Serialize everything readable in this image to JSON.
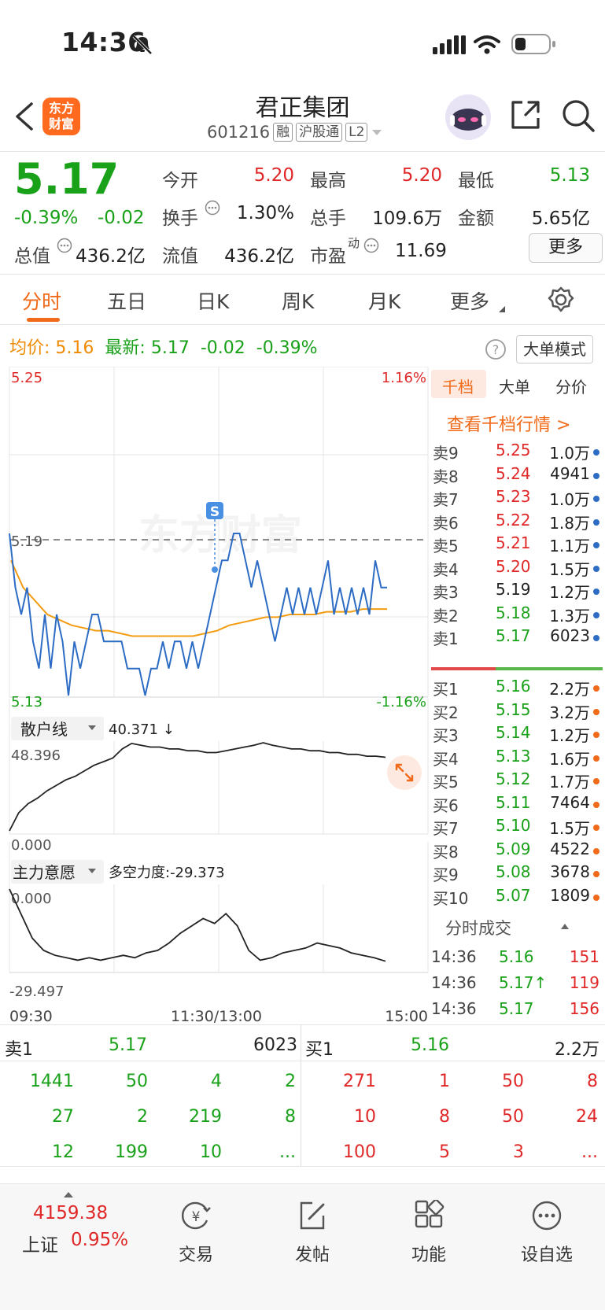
{
  "status": {
    "time": "14:36"
  },
  "header": {
    "logo_text": "东方\n财富",
    "title": "君正集团",
    "code": "601216",
    "tags": [
      "融",
      "沪股通",
      "L2"
    ]
  },
  "quote": {
    "price": "5.17",
    "change_pct": "-0.39%",
    "change": "-0.02",
    "open_label": "今开",
    "open": "5.20",
    "high_label": "最高",
    "high": "5.20",
    "low_label": "最低",
    "low": "5.13",
    "turnover_label": "换手",
    "turnover": "1.30%",
    "volume_label": "总手",
    "volume": "109.6万",
    "amount_label": "金额",
    "amount": "5.65亿",
    "mktcap_label": "总值",
    "mktcap": "436.2亿",
    "float_label": "流值",
    "float": "436.2亿",
    "pe_label": "市盈",
    "pe_sup": "动",
    "pe": "11.69",
    "more": "更多"
  },
  "tabs": [
    "分时",
    "五日",
    "日K",
    "周K",
    "月K",
    "更多"
  ],
  "legend": {
    "avg_label": "均价:",
    "avg": "5.16",
    "latest_label": "最新:",
    "latest": "5.17",
    "chg": "-0.02",
    "pct": "-0.39%",
    "big_order_mode": "大单模式"
  },
  "chart_axes": {
    "price_top": "5.25",
    "price_mid": "5.19",
    "price_bot": "5.13",
    "pct_top": "1.16%",
    "pct_bot": "-1.16%",
    "times": [
      "09:30",
      "11:30/13:00",
      "15:00"
    ],
    "watermark": "东方财富",
    "marker": "S"
  },
  "indicator1": {
    "name": "散户线",
    "value": "40.371 ↓",
    "max": "48.396",
    "min": "0.000"
  },
  "indicator2": {
    "name": "主力意愿",
    "value": "多空力度:-29.373",
    "max": "0.000",
    "min": "-29.497"
  },
  "chart_data": [
    {
      "type": "line",
      "title": "",
      "series": [
        {
          "name": "",
          "values": [
            5.19,
            5.17,
            5.16,
            5.17,
            5.15,
            5.14,
            5.16,
            5.14,
            5.16,
            5.15,
            5.13,
            5.15,
            5.14,
            5.15,
            5.16,
            5.16,
            5.15,
            5.15,
            5.15,
            5.15,
            5.14,
            5.14,
            5.14,
            5.13,
            5.14,
            5.14,
            5.15,
            5.14,
            5.15,
            5.15,
            5.14,
            5.15,
            5.14,
            5.15,
            5.16,
            5.17,
            5.18,
            5.18,
            5.19,
            5.19,
            5.18,
            5.17,
            5.18,
            5.17,
            5.16,
            5.15,
            5.16,
            5.17,
            5.16,
            5.17,
            5.16,
            5.17,
            5.16,
            5.17,
            5.18,
            5.16,
            5.17,
            5.16,
            5.17,
            5.16,
            5.17,
            5.16,
            5.18,
            5.17,
            5.17
          ]
        },
        {
          "name": "均价",
          "values": [
            5.18,
            5.17,
            5.165,
            5.16,
            5.158,
            5.156,
            5.155,
            5.154,
            5.154,
            5.153,
            5.152,
            5.152,
            5.152,
            5.152,
            5.152,
            5.152,
            5.153,
            5.154,
            5.156,
            5.157,
            5.158,
            5.159,
            5.159,
            5.16,
            5.16,
            5.16,
            5.161,
            5.161,
            5.161,
            5.162,
            5.162,
            5.162
          ]
        }
      ],
      "ylim": [
        5.13,
        5.25
      ]
    },
    {
      "type": "line",
      "title": "",
      "series": [
        {
          "name": "散户线",
          "values": [
            0,
            10,
            15,
            18,
            22,
            25,
            28,
            30,
            33,
            36,
            38,
            40,
            45,
            48,
            47,
            46,
            46,
            45,
            45,
            44,
            44,
            43,
            43,
            44,
            45,
            46,
            47,
            48.4,
            47,
            46,
            45,
            45,
            44,
            44,
            43,
            43,
            42,
            42,
            41,
            41,
            40.4
          ]
        }
      ],
      "ylim": [
        0,
        48.396
      ]
    },
    {
      "type": "line",
      "title": "",
      "series": [
        {
          "name": "主力意愿",
          "values": [
            0,
            -10,
            -20,
            -25,
            -27,
            -28,
            -29,
            -28,
            -29,
            -28,
            -27,
            -28,
            -26,
            -25,
            -22,
            -18,
            -15,
            -12,
            -14,
            -10,
            -15,
            -25,
            -29,
            -28,
            -26,
            -25,
            -24,
            -22,
            -23,
            -24,
            -26,
            -27,
            -28,
            -29.4
          ]
        }
      ],
      "ylim": [
        -29.497,
        0
      ]
    }
  ],
  "orderbook": {
    "tabs": [
      "千档",
      "大单",
      "分价"
    ],
    "link": "查看千档行情 >",
    "sells": [
      {
        "label": "卖9",
        "price": "5.25",
        "vol": "1.0万"
      },
      {
        "label": "卖8",
        "price": "5.24",
        "vol": "4941"
      },
      {
        "label": "卖7",
        "price": "5.23",
        "vol": "1.0万"
      },
      {
        "label": "卖6",
        "price": "5.22",
        "vol": "1.8万"
      },
      {
        "label": "卖5",
        "price": "5.21",
        "vol": "1.1万"
      },
      {
        "label": "卖4",
        "price": "5.20",
        "vol": "1.5万"
      },
      {
        "label": "卖3",
        "price": "5.19",
        "vol": "1.2万"
      },
      {
        "label": "卖2",
        "price": "5.18",
        "vol": "1.3万"
      },
      {
        "label": "卖1",
        "price": "5.17",
        "vol": "6023"
      }
    ],
    "buys": [
      {
        "label": "买1",
        "price": "5.16",
        "vol": "2.2万"
      },
      {
        "label": "买2",
        "price": "5.15",
        "vol": "3.2万"
      },
      {
        "label": "买3",
        "price": "5.14",
        "vol": "1.2万"
      },
      {
        "label": "买4",
        "price": "5.13",
        "vol": "1.6万"
      },
      {
        "label": "买5",
        "price": "5.12",
        "vol": "1.7万"
      },
      {
        "label": "买6",
        "price": "5.11",
        "vol": "7464"
      },
      {
        "label": "买7",
        "price": "5.10",
        "vol": "1.5万"
      },
      {
        "label": "买8",
        "price": "5.09",
        "vol": "4522"
      },
      {
        "label": "买9",
        "price": "5.08",
        "vol": "3678"
      },
      {
        "label": "买10",
        "price": "5.07",
        "vol": "1809"
      }
    ],
    "ticks_title": "分时成交",
    "ticks": [
      {
        "time": "14:36",
        "price": "5.16",
        "vol": "151"
      },
      {
        "time": "14:36",
        "price": "5.17↑",
        "vol": "119"
      },
      {
        "time": "14:36",
        "price": "5.17",
        "vol": "156"
      }
    ]
  },
  "queue": {
    "sell_label": "卖1",
    "sell_price": "5.17",
    "sell_vol": "6023",
    "buy_label": "买1",
    "buy_price": "5.16",
    "buy_vol": "2.2万",
    "sell_rows": [
      [
        "1441",
        "50",
        "4",
        "2"
      ],
      [
        "27",
        "2",
        "219",
        "8"
      ],
      [
        "12",
        "199",
        "10",
        "..."
      ]
    ],
    "buy_rows": [
      [
        "271",
        "1",
        "50",
        "8"
      ],
      [
        "10",
        "8",
        "50",
        "24"
      ],
      [
        "100",
        "5",
        "3",
        "..."
      ]
    ]
  },
  "bottom_nav": {
    "index_value": "4159.38",
    "index_name": "上证",
    "index_pct": "0.95%",
    "items": [
      "交易",
      "发帖",
      "功能",
      "设自选"
    ]
  }
}
